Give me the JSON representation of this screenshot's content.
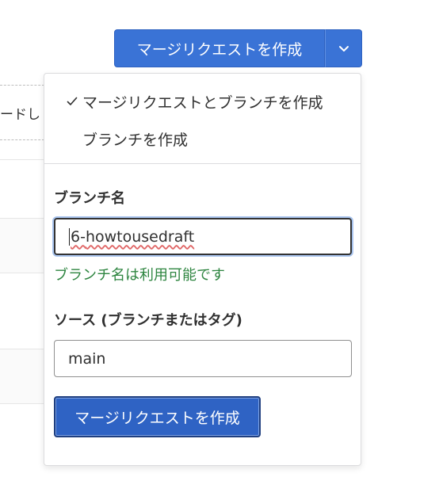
{
  "background": {
    "partial_text": "ードし"
  },
  "split_button": {
    "main_label": "マージリクエストを作成",
    "toggle_icon": "chevron-down-icon"
  },
  "dropdown": {
    "options": [
      {
        "label": "マージリクエストとブランチを作成",
        "selected": true
      },
      {
        "label": "ブランチを作成",
        "selected": false
      }
    ],
    "branch_name": {
      "label": "ブランチ名",
      "value_prefix": "6-",
      "value_rest": "howtousedraft",
      "status": "ブランチ名は利用可能です"
    },
    "source": {
      "label": "ソース (ブランチまたはタグ)",
      "value": "main"
    },
    "submit_label": "マージリクエストを作成"
  },
  "colors": {
    "primary": "#3a73d6",
    "success": "#2e8540",
    "text": "#303030"
  }
}
